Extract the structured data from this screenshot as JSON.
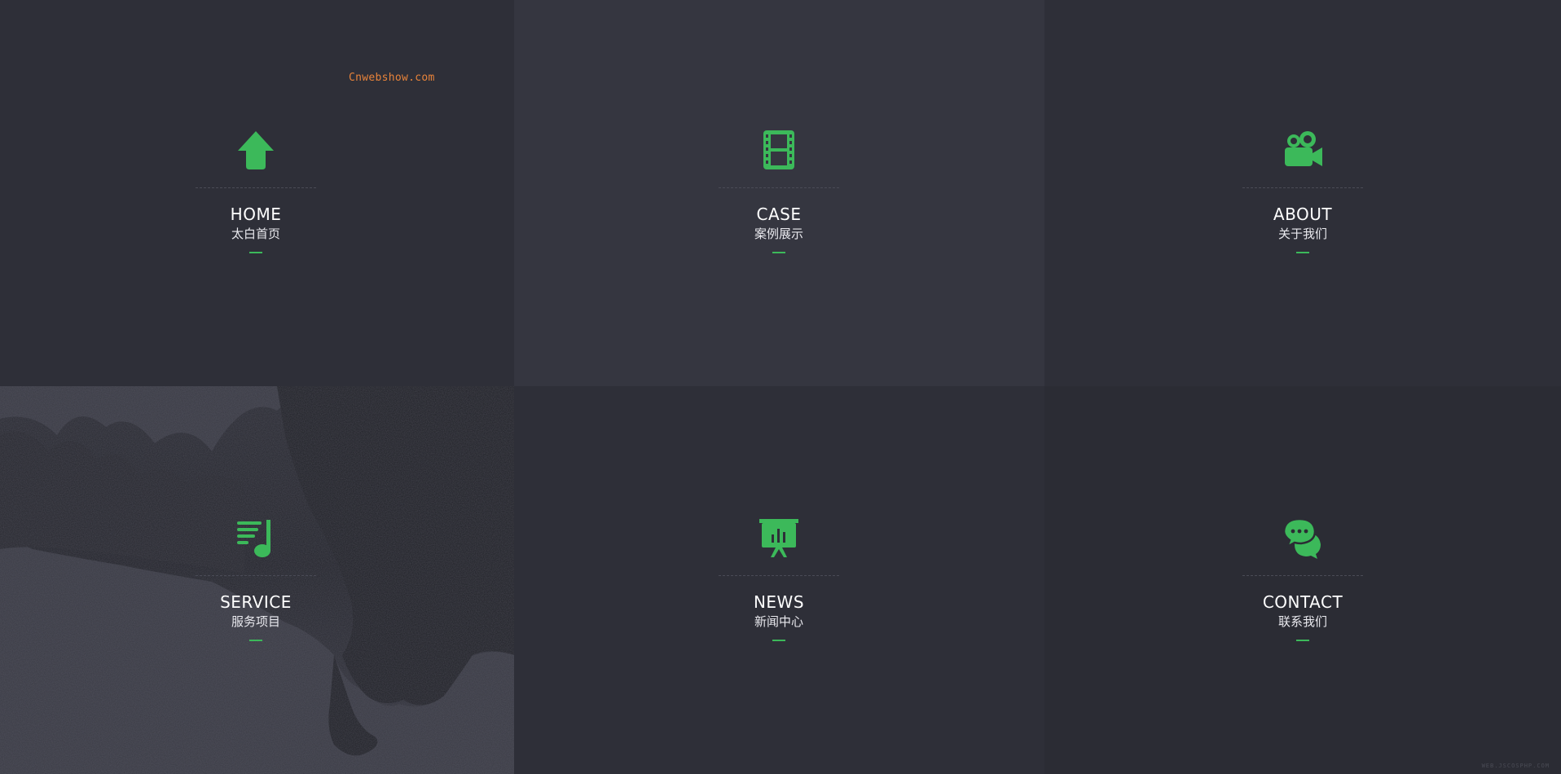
{
  "brand": {
    "text": "Cnwebshow.com",
    "color": "#e8833a"
  },
  "accent_color": "#3cb95a",
  "nav": [
    {
      "key": "home",
      "en": "HOME",
      "cn": "太白首页",
      "icon": "house-arrow-icon"
    },
    {
      "key": "case",
      "en": "CASE",
      "cn": "案例展示",
      "icon": "film-strip-icon"
    },
    {
      "key": "about",
      "en": "ABOUT",
      "cn": "关于我们",
      "icon": "video-camera-icon"
    },
    {
      "key": "service",
      "en": "SERVICE",
      "cn": "服务项目",
      "icon": "music-list-icon"
    },
    {
      "key": "news",
      "en": "NEWS",
      "cn": "新闻中心",
      "icon": "presentation-board-icon"
    },
    {
      "key": "contact",
      "en": "CONTACT",
      "cn": "联系我们",
      "icon": "chat-bubbles-icon"
    }
  ],
  "watermark": "WEB.JSCOSPHP.COM"
}
